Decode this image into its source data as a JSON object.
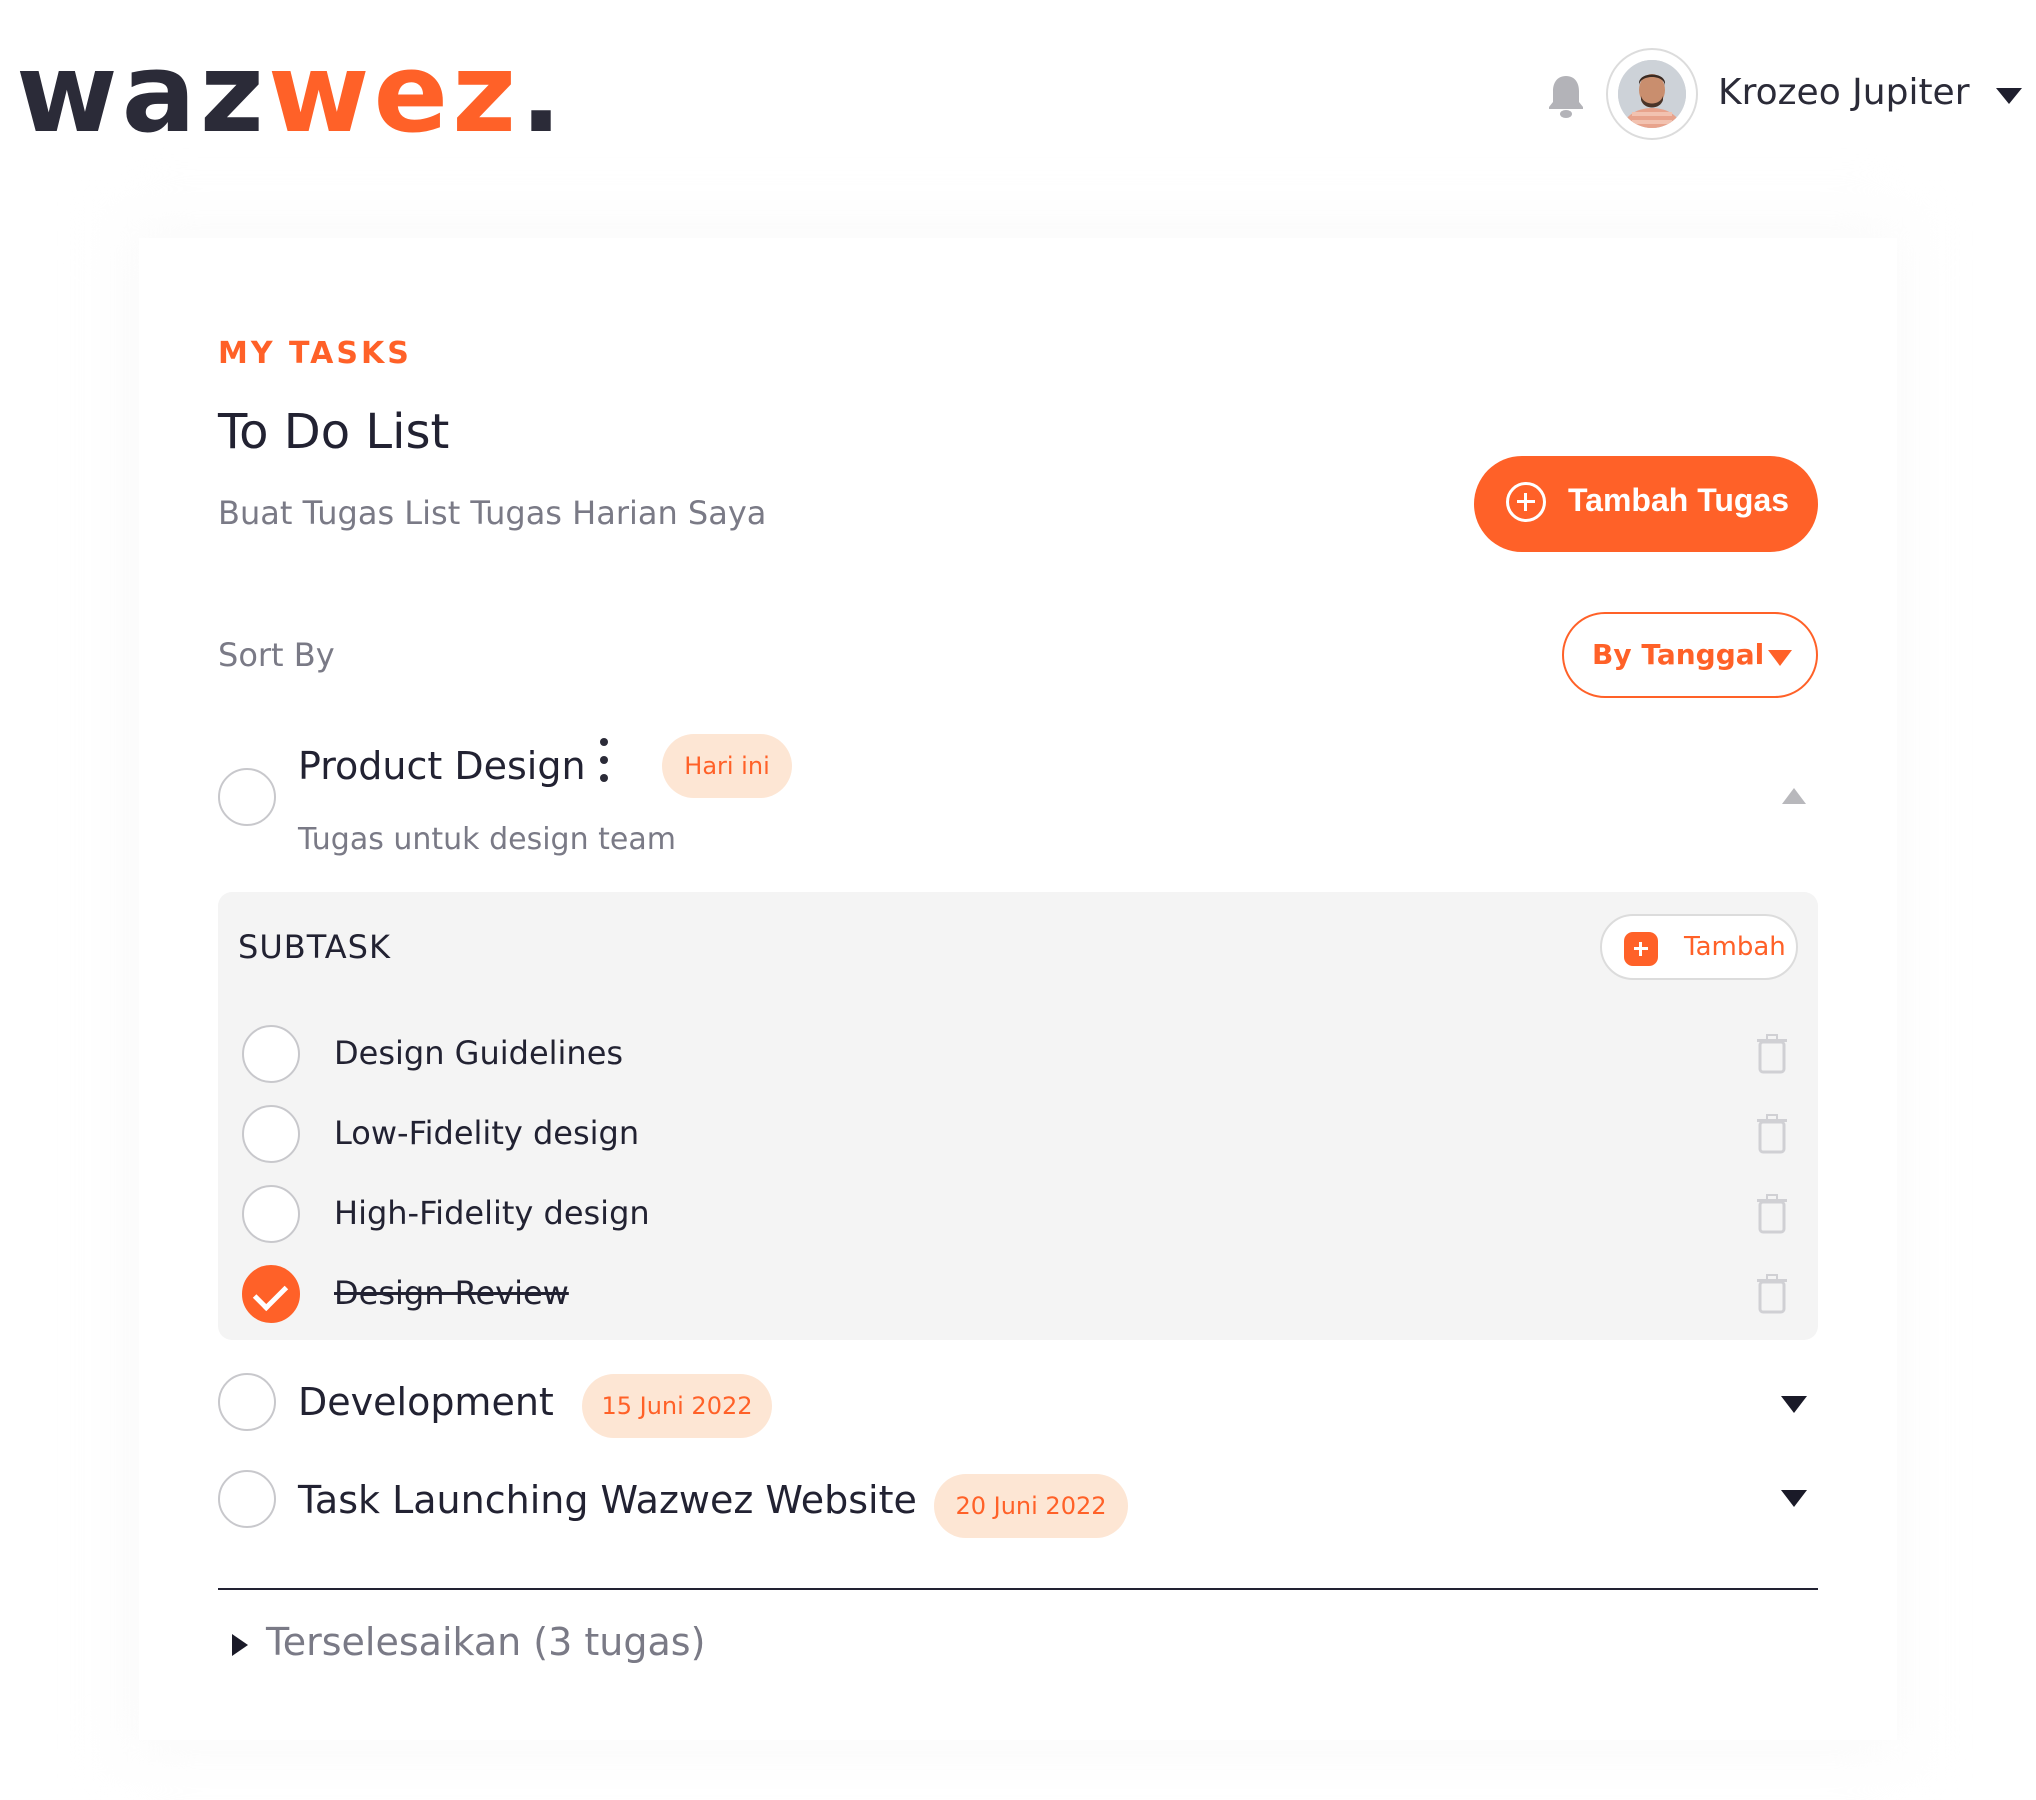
{
  "brand": {
    "logo_dark": "waz",
    "logo_accent": "wez",
    "logo_dot": "."
  },
  "header": {
    "user_name": "Krozeo Jupiter",
    "icons": {
      "notifications": "bell-icon",
      "user_menu": "caret-down-icon"
    }
  },
  "page": {
    "eyebrow": "MY TASKS",
    "title": "To Do List",
    "subtitle": "Buat Tugas List Tugas Harian Saya",
    "add_button_label": "Tambah Tugas",
    "sort_label": "Sort By",
    "sort_value": "By Tanggal"
  },
  "tasks": [
    {
      "title": "Product Design",
      "description": "Tugas untuk design team",
      "badge": "Hari ini",
      "expanded": true,
      "subtask_heading": "SUBTASK",
      "subtask_add_label": "Tambah",
      "subtasks": [
        {
          "label": "Design Guidelines",
          "done": false
        },
        {
          "label": "Low-Fidelity design",
          "done": false
        },
        {
          "label": "High-Fidelity design",
          "done": false
        },
        {
          "label": "Design Review",
          "done": true
        }
      ]
    },
    {
      "title": "Development",
      "badge": "15 Juni 2022",
      "expanded": false
    },
    {
      "title": "Task Launching Wazwez Website",
      "badge": "20 Juni 2022",
      "expanded": false
    }
  ],
  "completed_section": {
    "label": "Terselesaikan (3 tugas)"
  },
  "colors": {
    "accent": "#ff6128",
    "badge_bg": "#fde6d4",
    "panel_bg": "#f4f4f4",
    "text_dark": "#222232",
    "text_muted": "#7a7a86"
  }
}
